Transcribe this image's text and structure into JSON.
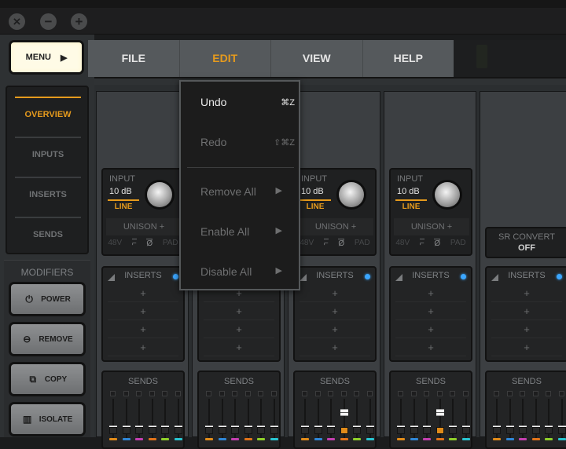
{
  "window": {
    "close": "×",
    "minimize": "−",
    "maximize": "+"
  },
  "menu_button": {
    "label": "MENU",
    "arrow": "▶"
  },
  "menubar": [
    {
      "label": "FILE",
      "active": false
    },
    {
      "label": "EDIT",
      "active": true
    },
    {
      "label": "VIEW",
      "active": false
    },
    {
      "label": "HELP",
      "active": false
    }
  ],
  "nav": [
    {
      "label": "OVERVIEW",
      "active": true
    },
    {
      "label": "INPUTS",
      "active": false
    },
    {
      "label": "INSERTS",
      "active": false
    },
    {
      "label": "SENDS",
      "active": false
    }
  ],
  "modifiers": {
    "title": "MODIFIERS",
    "buttons": [
      {
        "label": "POWER",
        "icon": "power-icon",
        "glyph": "⏻"
      },
      {
        "label": "REMOVE",
        "icon": "minus-circle-icon",
        "glyph": "⊖"
      },
      {
        "label": "COPY",
        "icon": "copy-icon",
        "glyph": "⧉"
      },
      {
        "label": "ISOLATE",
        "icon": "isolate-icon",
        "glyph": "▥"
      }
    ]
  },
  "edit_menu": {
    "items": [
      {
        "label": "Undo",
        "shortcut": "⌘Z",
        "enabled": true
      },
      {
        "label": "Redo",
        "shortcut": "⇧⌘Z",
        "enabled": false
      },
      {
        "label": "Remove All",
        "submenu": "▶",
        "enabled": false
      },
      {
        "label": "Enable All",
        "submenu": "▶",
        "enabled": false
      },
      {
        "label": "Disable All",
        "submenu": "▶",
        "enabled": false
      }
    ]
  },
  "channel": {
    "input_label": "INPUT",
    "gain": "10 dB",
    "type": "LINE",
    "unison": "UNISON +",
    "switches": [
      "48V",
      "⌐",
      "Ø",
      "PAD"
    ],
    "inserts_title": "INSERTS",
    "insert_slot": "+",
    "sends_title": "SENDS"
  },
  "sr_convert": {
    "label": "SR CONVERT",
    "value": "OFF"
  },
  "send_colors": [
    "#e08b1a",
    "#2f86d6",
    "#c23fae",
    "#e0731a",
    "#8fcf2a",
    "#29c4d0"
  ],
  "channels": [
    {
      "sends": [
        0.1,
        0.1,
        0.1,
        0.1,
        0.1,
        0.1
      ],
      "active_send": -1
    },
    {
      "sends": [
        0.1,
        0.1,
        0.1,
        0.1,
        0.1,
        0.1
      ],
      "active_send": -1
    },
    {
      "sends": [
        0.1,
        0.1,
        0.1,
        0.65,
        0.1,
        0.1
      ],
      "active_send": 3
    },
    {
      "sends": [
        0.1,
        0.1,
        0.1,
        0.65,
        0.1,
        0.1
      ],
      "active_send": 3
    },
    {
      "sends": [
        0.1,
        0.1,
        0.1,
        0.1,
        0.1,
        0.1
      ],
      "active_send": -1
    }
  ]
}
